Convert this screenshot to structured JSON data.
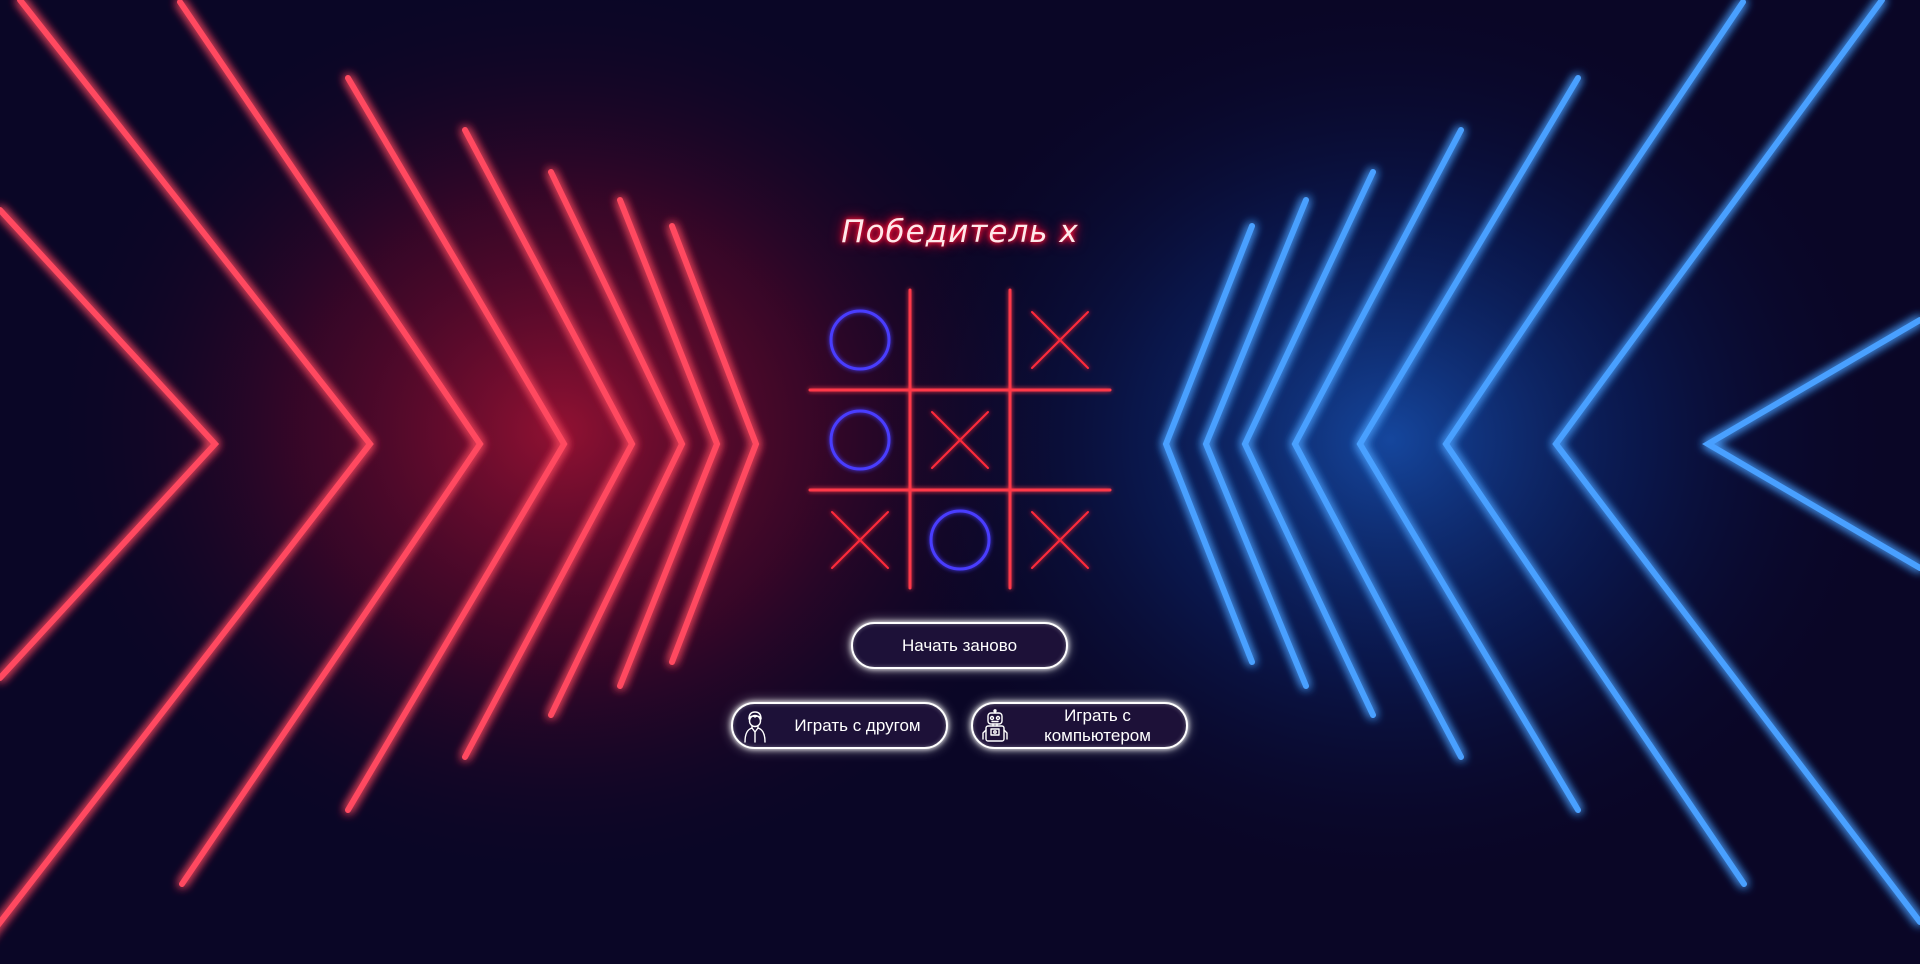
{
  "colors": {
    "x": "#ff2a3a",
    "o": "#4a3cff",
    "red_neon": "#ff1a3c",
    "blue_neon": "#1e7bff",
    "background": "#0a0626"
  },
  "title": "Победитель  x",
  "board": [
    "o",
    "",
    "x",
    "o",
    "x",
    "",
    "x",
    "o",
    "x"
  ],
  "buttons": {
    "restart": "Начать заново",
    "play_friend": "Играть с другом",
    "play_computer": "Играть с компьютером"
  },
  "icons": {
    "friend": "person-icon",
    "computer": "robot-icon"
  }
}
